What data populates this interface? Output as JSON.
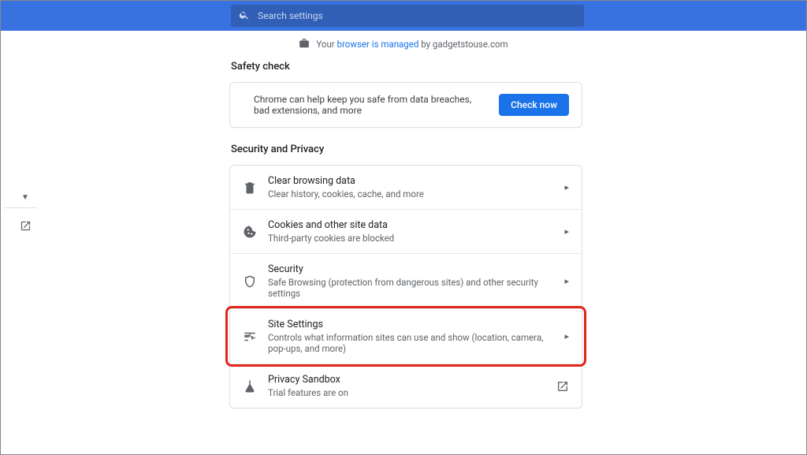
{
  "search": {
    "placeholder": "Search settings"
  },
  "banner": {
    "prefix": "Your ",
    "link": "browser is managed",
    "suffix": " by gadgetstouse.com"
  },
  "safety_check": {
    "heading": "Safety check",
    "text": "Chrome can help keep you safe from data breaches, bad extensions, and more",
    "button": "Check now"
  },
  "security_privacy": {
    "heading": "Security and Privacy",
    "items": [
      {
        "title": "Clear browsing data",
        "sub": "Clear history, cookies, cache, and more"
      },
      {
        "title": "Cookies and other site data",
        "sub": "Third-party cookies are blocked"
      },
      {
        "title": "Security",
        "sub": "Safe Browsing (protection from dangerous sites) and other security settings"
      },
      {
        "title": "Site Settings",
        "sub": "Controls what information sites can use and show (location, camera, pop-ups, and more)"
      },
      {
        "title": "Privacy Sandbox",
        "sub": "Trial features are on"
      }
    ]
  },
  "highlight_index": 3
}
